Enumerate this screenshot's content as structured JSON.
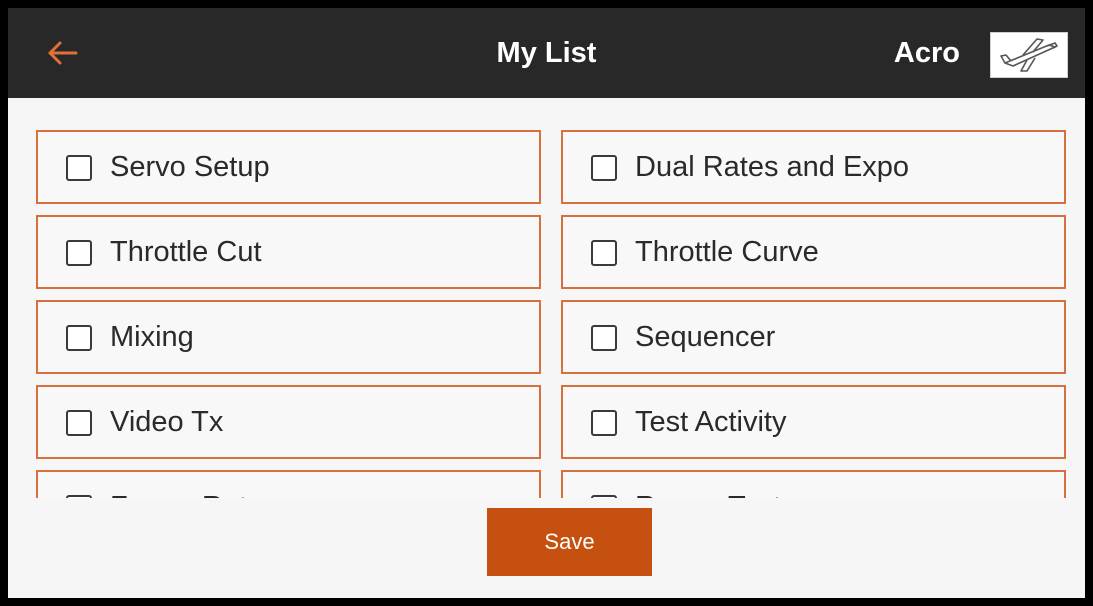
{
  "header": {
    "title": "My List",
    "model_name": "Acro",
    "back_icon": "arrow-left-icon",
    "model_icon": "airplane-icon"
  },
  "colors": {
    "header_bg": "#282828",
    "accent": "#d7703f",
    "save_button": "#c5500f",
    "background": "#f6f6f6"
  },
  "list": {
    "items": [
      {
        "label": "Servo Setup",
        "checked": false
      },
      {
        "label": "Dual Rates and Expo",
        "checked": false
      },
      {
        "label": "Throttle Cut",
        "checked": false
      },
      {
        "label": "Throttle Curve",
        "checked": false
      },
      {
        "label": "Mixing",
        "checked": false
      },
      {
        "label": "Sequencer",
        "checked": false
      },
      {
        "label": "Video Tx",
        "checked": false
      },
      {
        "label": "Test Activity",
        "checked": false
      },
      {
        "label": "Frame Rate",
        "checked": false
      },
      {
        "label": "Range Test",
        "checked": false
      }
    ]
  },
  "footer": {
    "save_label": "Save"
  }
}
